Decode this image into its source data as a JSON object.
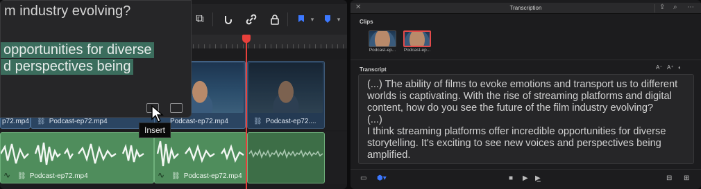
{
  "timeline": {
    "caption_preview": {
      "question_tail": "m industry evolving?",
      "answer_line1": "opportunities for diverse",
      "answer_line2": "d perspectives being"
    },
    "tooltip": "Insert",
    "video_clips": [
      {
        "label": "p72.mp4"
      },
      {
        "label": "Podcast-ep72.mp4"
      },
      {
        "label": "Podcast-ep72.mp4"
      },
      {
        "label": "Podcast-ep72...."
      }
    ],
    "audio_clips": [
      {
        "label": "Podcast-ep72.mp4"
      },
      {
        "label": "Podcast-ep72.mp4"
      }
    ],
    "playhead_color": "#e8403b"
  },
  "transcription": {
    "title": "Transcription",
    "clips_label": "Clips",
    "clips": [
      {
        "label": "Podcast-ep...",
        "selected": false
      },
      {
        "label": "Podcast-ep...",
        "selected": true
      }
    ],
    "transcript_label": "Transcript",
    "font_smaller": "A⁻",
    "font_larger": "A⁺",
    "lines": [
      "(...) The ability of films to evoke emotions and transport us to different",
      "worlds is captivating. With the rise of streaming platforms and digital",
      "content, how do you see the future of the film industry evolving?",
      "(...)",
      "I think streaming platforms offer incredible opportunities for diverse",
      "storytelling. It's exciting to see new voices and perspectives being",
      "amplified."
    ]
  },
  "colors": {
    "accent_blue": "#3c78ff",
    "audio_green": "#4f8d5c",
    "video_blue": "#2b4562",
    "selection_red": "#e24a4a"
  }
}
